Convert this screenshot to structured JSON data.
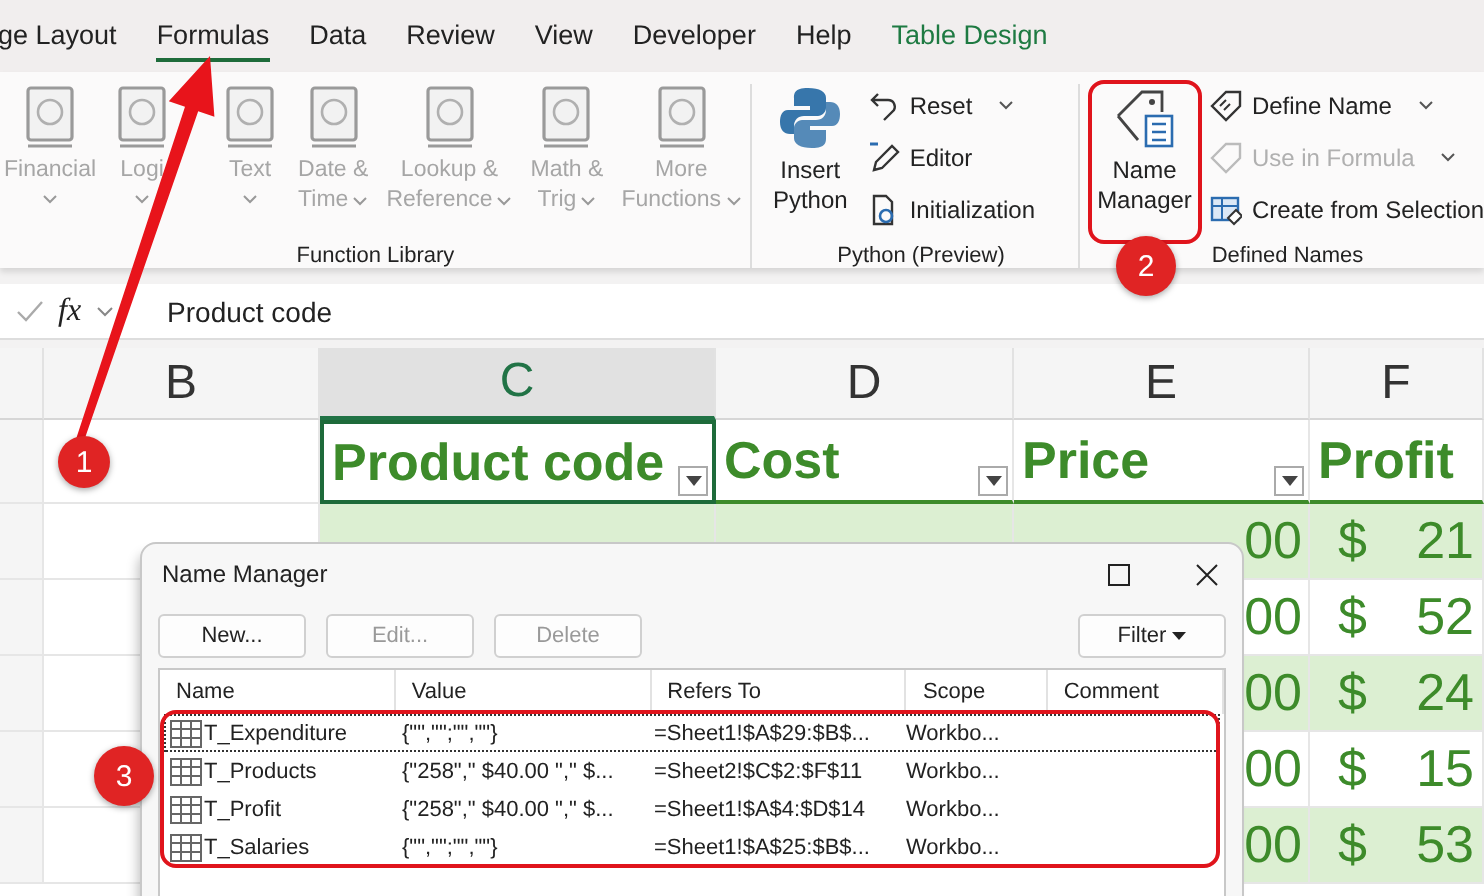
{
  "tabs": [
    {
      "label": "ge Layout",
      "selected": false,
      "kind": "normal"
    },
    {
      "label": "Formulas",
      "selected": true,
      "kind": "normal"
    },
    {
      "label": "Data",
      "selected": false,
      "kind": "normal"
    },
    {
      "label": "Review",
      "selected": false,
      "kind": "normal"
    },
    {
      "label": "View",
      "selected": false,
      "kind": "normal"
    },
    {
      "label": "Developer",
      "selected": false,
      "kind": "normal"
    },
    {
      "label": "Help",
      "selected": false,
      "kind": "normal"
    },
    {
      "label": "Table Design",
      "selected": false,
      "kind": "contextual"
    }
  ],
  "ribbon": {
    "groups": [
      {
        "label": "Function Library",
        "large_items": [
          {
            "lines": [
              "Financial"
            ],
            "disabled": true,
            "caret": true
          },
          {
            "lines": [
              "Logi"
            ],
            "disabled": true,
            "caret": true
          },
          {
            "lines": [
              "Text"
            ],
            "disabled": true,
            "caret": true
          },
          {
            "lines": [
              "Date &",
              "Time"
            ],
            "disabled": true,
            "caret": true
          },
          {
            "lines": [
              "Lookup &",
              "Reference"
            ],
            "disabled": true,
            "caret": true
          },
          {
            "lines": [
              "Math &",
              "Trig"
            ],
            "disabled": true,
            "caret": true
          },
          {
            "lines": [
              "More",
              "Functions"
            ],
            "disabled": true,
            "caret": true
          }
        ]
      },
      {
        "label": "Python (Preview)",
        "large_items": [
          {
            "lines": [
              "Insert",
              "Python"
            ],
            "disabled": false,
            "caret": false
          }
        ],
        "small_items": [
          {
            "label": "Reset",
            "disabled": false,
            "caret": true
          },
          {
            "label": "Editor",
            "disabled": false,
            "caret": false
          },
          {
            "label": "Initialization",
            "disabled": false,
            "caret": false
          }
        ]
      },
      {
        "label": "Defined Names",
        "large_items": [
          {
            "lines": [
              "Name",
              "Manager"
            ],
            "disabled": false,
            "caret": false
          }
        ],
        "small_items": [
          {
            "label": "Define Name",
            "disabled": false,
            "caret": true
          },
          {
            "label": "Use in Formula",
            "disabled": true,
            "caret": true
          },
          {
            "label": "Create from Selection",
            "disabled": false,
            "caret": false
          }
        ]
      }
    ]
  },
  "formula_bar": {
    "fx_label": "fx",
    "value": "Product code"
  },
  "sheet": {
    "columns": [
      {
        "label": "B",
        "selected": false
      },
      {
        "label": "C",
        "selected": true
      },
      {
        "label": "D",
        "selected": false
      },
      {
        "label": "E",
        "selected": false
      },
      {
        "label": "F",
        "selected": false
      }
    ],
    "table_headers": [
      "Product code",
      "Cost",
      "Price",
      "Profit"
    ],
    "rows": [
      {
        "banded": true,
        "price": "00",
        "profit_symbol": "$",
        "profit": "21"
      },
      {
        "banded": false,
        "price": "00",
        "profit_symbol": "$",
        "profit": "52"
      },
      {
        "banded": true,
        "price": "00",
        "profit_symbol": "$",
        "profit": "24"
      },
      {
        "banded": false,
        "price": "00",
        "profit_symbol": "$",
        "profit": "15"
      },
      {
        "banded": true,
        "price": "00",
        "profit_symbol": "$",
        "profit": "53"
      }
    ]
  },
  "dialog": {
    "title": "Name Manager",
    "buttons": [
      {
        "label": "New...",
        "disabled": false
      },
      {
        "label": "Edit...",
        "disabled": true
      },
      {
        "label": "Delete",
        "disabled": true
      }
    ],
    "filter_button": "Filter",
    "columns": [
      "Name",
      "Value",
      "Refers To",
      "Scope",
      "Comment"
    ],
    "rows": [
      {
        "name": "T_Expenditure",
        "value": "{\"\",\"\";\"\",\"\"}",
        "refers_to": "=Sheet1!$A$29:$B$...",
        "scope": "Workbo...",
        "selected": true
      },
      {
        "name": "T_Products",
        "value": "{\"258\",\" $40.00 \",\" $...",
        "refers_to": "=Sheet2!$C$2:$F$11",
        "scope": "Workbo...",
        "selected": false
      },
      {
        "name": "T_Profit",
        "value": "{\"258\",\" $40.00 \",\" $...",
        "refers_to": "=Sheet1!$A$4:$D$14",
        "scope": "Workbo...",
        "selected": false
      },
      {
        "name": "T_Salaries",
        "value": "{\"\",\"\";\"\",\"\"}",
        "refers_to": "=Sheet1!$A$25:$B$...",
        "scope": "Workbo...",
        "selected": false
      }
    ]
  },
  "annotations": [
    {
      "label": "1"
    },
    {
      "label": "2"
    },
    {
      "label": "3"
    }
  ]
}
